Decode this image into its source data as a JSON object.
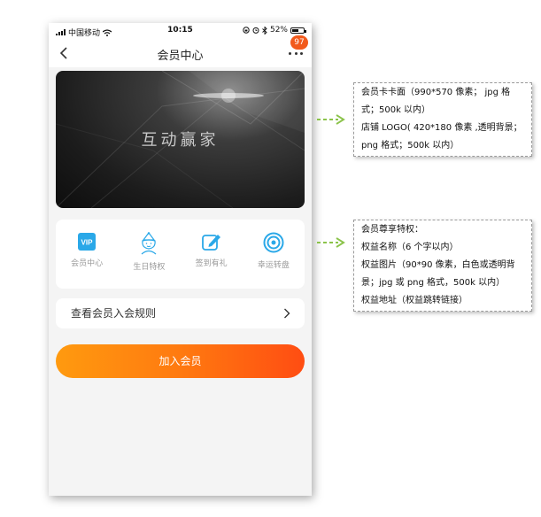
{
  "status_bar": {
    "carrier": "中国移动",
    "time": "10:15",
    "battery": "52%"
  },
  "nav": {
    "title": "会员中心",
    "badge": "97"
  },
  "card": {
    "text": "互动赢家"
  },
  "privileges": [
    {
      "label": "会员中心",
      "icon": "vip-icon",
      "color": "#2aa8e8"
    },
    {
      "label": "生日特权",
      "icon": "birthday-icon",
      "color": "#2aa8e8"
    },
    {
      "label": "签到有礼",
      "icon": "edit-icon",
      "color": "#2aa8e8"
    },
    {
      "label": "幸运转盘",
      "icon": "target-icon",
      "color": "#2aa8e8"
    }
  ],
  "rules_row": {
    "label": "查看会员入会规则"
  },
  "join_button": {
    "label": "加入会员",
    "gradient": [
      "#ff9a0f",
      "#ff4d12"
    ]
  },
  "annotations": {
    "card_note": [
      "会员卡卡面（990*570 像素； jpg 格",
      "式；500k 以内）",
      "店铺 LOGO( 420*180 像素 ,透明背景；",
      "png 格式；500k 以内）"
    ],
    "privileges_note": [
      "会员尊享特权：",
      "权益名称（6 个字以内）",
      "权益图片（90*90 像素，白色或透明背",
      "景；jpg 或 png 格式，500k 以内）",
      "权益地址（权益跳转链接）"
    ],
    "arrow_color": "#8bc34a"
  }
}
